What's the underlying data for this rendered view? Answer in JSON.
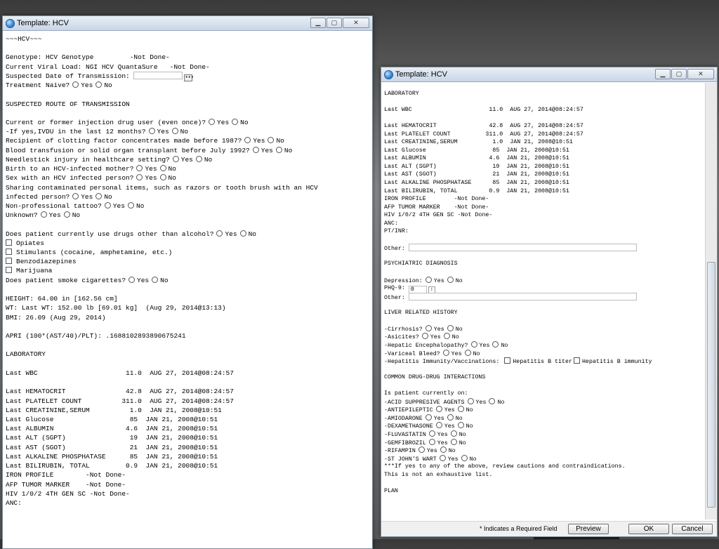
{
  "left_window": {
    "title": "Template: HCV",
    "lines": [
      {
        "t": "~~~HCV~~~"
      },
      {
        "t": ""
      },
      {
        "t": "Genotype: HCV Genotype         -Not Done-"
      },
      {
        "t": "Current Viral Load: NGI HCV QuantaSure   -Not Done-"
      },
      {
        "t": "Suspected Date of Transmission: ",
        "field": 70,
        "ellipsis": true
      },
      {
        "t": "Treatment Naive?",
        "opts": [
          "Yes",
          "No"
        ]
      },
      {
        "t": ""
      },
      {
        "t": "SUSPECTED ROUTE OF TRANSMISSION"
      },
      {
        "t": ""
      },
      {
        "t": "Current or former injection drug user (even once)?",
        "opts": [
          "Yes",
          "No"
        ]
      },
      {
        "t": "-If yes,IVDU in the last 12 months?",
        "opts": [
          "Yes",
          "No"
        ]
      },
      {
        "t": "Recipient of clotting factor concentrates made before 1987?",
        "opts": [
          "Yes",
          "No"
        ]
      },
      {
        "t": "Blood transfusion or solid organ transplant before July 1992?",
        "opts": [
          "Yes",
          "No"
        ]
      },
      {
        "t": "Needlestick injury in healthcare setting?",
        "opts": [
          "Yes",
          "No"
        ]
      },
      {
        "t": "Birth to an HCV-infected mother?",
        "opts": [
          "Yes",
          "No"
        ]
      },
      {
        "t": "Sex with an HCV infected person?",
        "opts": [
          "Yes",
          "No"
        ]
      },
      {
        "t": "Sharing contaminated personal items, such as razors or tooth brush with an HCV"
      },
      {
        "t": "infected person?",
        "opts": [
          "Yes",
          "No"
        ]
      },
      {
        "t": "Non-professional tattoo?",
        "opts": [
          "Yes",
          "No"
        ]
      },
      {
        "t": "Unknown?",
        "opts": [
          "Yes",
          "No"
        ]
      },
      {
        "t": ""
      },
      {
        "t": "Does patient currently use drugs other than alcohol?",
        "opts": [
          "Yes",
          "No"
        ]
      },
      {
        "t": "Opiates",
        "check": true
      },
      {
        "t": "Stimulants (cocaine, amphetamine, etc.)",
        "check": true
      },
      {
        "t": "Benzodiazepines",
        "check": true
      },
      {
        "t": "Marijuana",
        "check": true
      },
      {
        "t": "Does patient smoke cigarettes?",
        "opts": [
          "Yes",
          "No"
        ]
      },
      {
        "t": ""
      },
      {
        "t": "HEIGHT: 64.00 in [162.56 cm]"
      },
      {
        "t": "WT: Last WT: 152.00 lb [69.01 kg]  (Aug 29, 2014@13:13)"
      },
      {
        "t": "BMI: 26.09 (Aug 29, 2014)"
      },
      {
        "t": ""
      },
      {
        "t": "APRI (100*(AST/40)/PLT): .1688102893890675241"
      },
      {
        "t": ""
      },
      {
        "t": "LABORATORY"
      },
      {
        "t": ""
      },
      {
        "t": "Last WBC                      11.0  AUG 27, 2014@08:24:57"
      },
      {
        "t": ""
      },
      {
        "t": "Last HEMATOCRIT               42.8  AUG 27, 2014@08:24:57"
      },
      {
        "t": "Last PLATELET COUNT          311.0  AUG 27, 2014@08:24:57"
      },
      {
        "t": "Last CREATININE,SERUM          1.0  JAN 21, 2008@10:51"
      },
      {
        "t": "Last Glucose                   85  JAN 21, 2008@10:51"
      },
      {
        "t": "Last ALBUMIN                  4.6  JAN 21, 2008@10:51"
      },
      {
        "t": "Last ALT (SGPT)                19  JAN 21, 2008@10:51"
      },
      {
        "t": "Last AST (SGOT)                21  JAN 21, 2008@10:51"
      },
      {
        "t": "Last ALKALINE PHOSPHATASE      85  JAN 21, 2008@10:51"
      },
      {
        "t": "Last BILIRUBIN, TOTAL         0.9  JAN 21, 2008@10:51"
      },
      {
        "t": "IRON PROFILE        -Not Done-"
      },
      {
        "t": "AFP TUMOR MARKER    -Not Done-"
      },
      {
        "t": "HIV 1/0/2 4TH GEN SC -Not Done-"
      },
      {
        "t": "ANC:"
      }
    ]
  },
  "right_window": {
    "title": "Template: HCV",
    "lines": [
      {
        "t": "LABORATORY"
      },
      {
        "t": ""
      },
      {
        "t": "Last WBC                      11.0  AUG 27, 2014@08:24:57"
      },
      {
        "t": ""
      },
      {
        "t": "Last HEMATOCRIT               42.8  AUG 27, 2014@08:24:57"
      },
      {
        "t": "Last PLATELET COUNT          311.0  AUG 27, 2014@08:24:57"
      },
      {
        "t": "Last CREATININE,SERUM          1.0  JAN 21, 2008@10:51"
      },
      {
        "t": "Last Glucose                   85  JAN 21, 2008@10:51"
      },
      {
        "t": "Last ALBUMIN                  4.6  JAN 21, 2008@10:51"
      },
      {
        "t": "Last ALT (SGPT)                19  JAN 21, 2008@10:51"
      },
      {
        "t": "Last AST (SGOT)                21  JAN 21, 2008@10:51"
      },
      {
        "t": "Last ALKALINE PHOSPHATASE      85  JAN 21, 2008@10:51"
      },
      {
        "t": "Last BILIRUBIN, TOTAL         0.9  JAN 21, 2008@10:51"
      },
      {
        "t": "IRON PROFILE        -Not Done-"
      },
      {
        "t": "AFP TUMOR MARKER    -Not Done-"
      },
      {
        "t": "HIV 1/0/2 4TH GEN SC -Not Done-"
      },
      {
        "t": "ANC:"
      },
      {
        "t": "PT/INR:"
      },
      {
        "t": ""
      },
      {
        "t": "Other: ",
        "field": 325
      },
      {
        "t": ""
      },
      {
        "t": "PSYCHIATRIC DIAGNOSIS"
      },
      {
        "t": ""
      },
      {
        "t": "Depression:",
        "opts": [
          "Yes",
          "No"
        ]
      },
      {
        "t": "PHQ-9: ",
        "field": 26,
        "spin": true,
        "value": "0"
      },
      {
        "t": "Other: ",
        "field": 325
      },
      {
        "t": ""
      },
      {
        "t": "LIVER RELATED HISTORY"
      },
      {
        "t": ""
      },
      {
        "t": "-Cirrhosis?",
        "opts": [
          "Yes",
          "No"
        ]
      },
      {
        "t": "-Asicites?",
        "opts": [
          "Yes",
          "No"
        ]
      },
      {
        "t": "-Hepatic Encephalopathy?",
        "opts": [
          "Yes",
          "No"
        ]
      },
      {
        "t": "-Variceal Bleed?",
        "opts": [
          "Yes",
          "No"
        ]
      },
      {
        "t": "-Hepatitis Immunity/Vaccinations: ",
        "checks": [
          "Hepatitis B titer",
          "Hepatitis B immunity"
        ]
      },
      {
        "t": ""
      },
      {
        "t": "COMMON DRUG-DRUG INTERACTIONS"
      },
      {
        "t": ""
      },
      {
        "t": "Is patient currently on:"
      },
      {
        "t": "-ACID SUPPRESIVE AGENTS",
        "opts": [
          "Yes",
          "No"
        ]
      },
      {
        "t": "-ANTIEPILEPTIC",
        "opts": [
          "Yes",
          "No"
        ]
      },
      {
        "t": "-AMIODARONE",
        "opts": [
          "Yes",
          "No"
        ]
      },
      {
        "t": "-DEXAMETHASONE",
        "opts": [
          "Yes",
          "No"
        ]
      },
      {
        "t": "-FLUVASTATIN",
        "opts": [
          "Yes",
          "No"
        ]
      },
      {
        "t": "-GEMFIBROZIL",
        "opts": [
          "Yes",
          "No"
        ]
      },
      {
        "t": "-RIFAMPIN",
        "opts": [
          "Yes",
          "No"
        ]
      },
      {
        "t": "-ST JOHN'S WART",
        "opts": [
          "Yes",
          "No"
        ]
      },
      {
        "t": "***If yes to any of the above, review cautions and contraindications."
      },
      {
        "t": "This is not an exhaustive list."
      },
      {
        "t": ""
      },
      {
        "t": "PLAN"
      }
    ],
    "footer": {
      "required_note": "* Indicates a Required Field",
      "preview_label": "Preview",
      "ok_label": "OK",
      "cancel_label": "Cancel"
    }
  }
}
